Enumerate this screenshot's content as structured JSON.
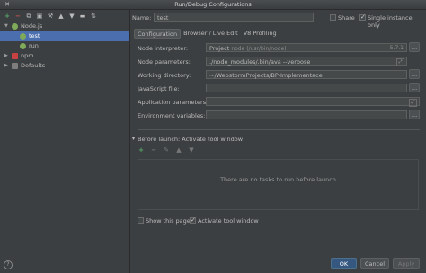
{
  "window": {
    "title": "Run/Debug Configurations"
  },
  "toolbar": {
    "icons": [
      "plus-icon",
      "minus-icon",
      "copy-icon",
      "save-icon",
      "wrench-icon",
      "arrow-up-icon",
      "arrow-down-icon",
      "folder-icon",
      "sort-icon"
    ]
  },
  "tree": {
    "nodejs": "Node.js",
    "test": "test",
    "run": "run",
    "npm": "npm",
    "defaults": "Defaults"
  },
  "form": {
    "name_label": "Name:",
    "name_value": "test",
    "share_label": "Share",
    "single_instance_label": "Single instance only",
    "single_instance_checked": true
  },
  "tabs": [
    "Configuration",
    "Browser / Live Edit",
    "V8 Profiling"
  ],
  "config": {
    "node_interpreter_label": "Node interpreter:",
    "node_interpreter_value": "Project",
    "node_interpreter_hint": "node (/usr/bin/node)",
    "node_interpreter_version": "5.7.1",
    "node_parameters_label": "Node parameters:",
    "node_parameters_value": "./node_modules/.bin/ava  --verbose",
    "working_directory_label": "Working directory:",
    "working_directory_value": "~/WebstormProjects/BP-Implementace",
    "javascript_file_label": "JavaScript file:",
    "javascript_file_value": "",
    "app_params_label": "Application parameters:",
    "app_params_value": "",
    "env_vars_label": "Environment variables:",
    "env_vars_value": ""
  },
  "before_launch": {
    "header": "Before launch: Activate tool window",
    "empty_text": "There are no tasks to run before launch",
    "show_page_label": "Show this page",
    "show_page_checked": false,
    "activate_tool_label": "Activate tool window",
    "activate_tool_checked": true
  },
  "buttons": {
    "ok": "OK",
    "cancel": "Cancel",
    "apply": "Apply"
  }
}
